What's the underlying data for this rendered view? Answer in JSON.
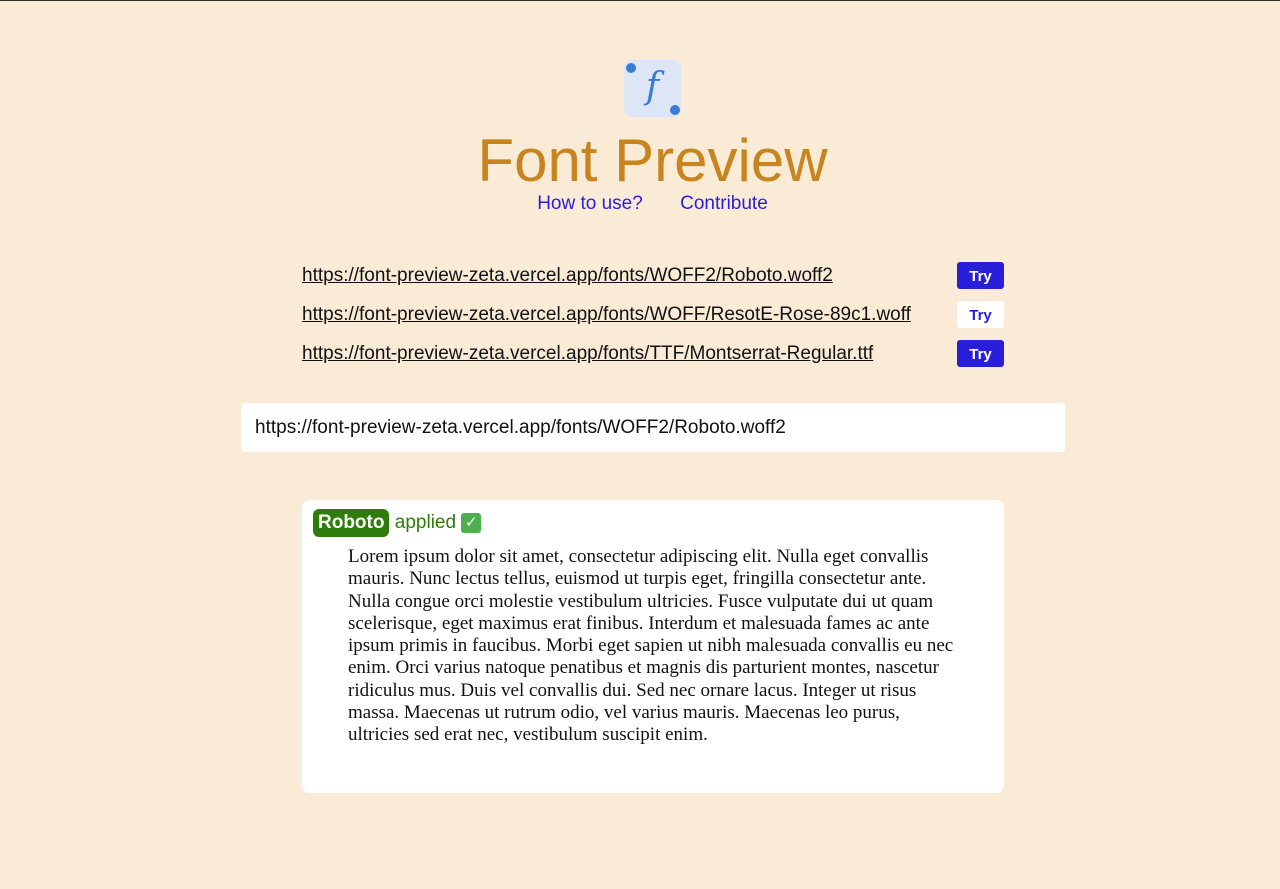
{
  "app": {
    "logo_glyph": "f",
    "title": "Font Preview"
  },
  "nav": {
    "how_to_use": "How to use?",
    "contribute": "Contribute"
  },
  "font_rows": [
    {
      "url": "https://font-preview-zeta.vercel.app/fonts/WOFF2/Roboto.woff2",
      "button": "Try",
      "style": "primary"
    },
    {
      "url": "https://font-preview-zeta.vercel.app/fonts/WOFF/ResotE-Rose-89c1.woff",
      "button": "Try",
      "style": "secondary"
    },
    {
      "url": "https://font-preview-zeta.vercel.app/fonts/TTF/Montserrat-Regular.ttf",
      "button": "Try",
      "style": "primary"
    }
  ],
  "input": {
    "value": "https://font-preview-zeta.vercel.app/fonts/WOFF2/Roboto.woff2"
  },
  "preview": {
    "font_name": "Roboto",
    "status_text": "applied",
    "status_icon": "check-mark-icon",
    "sample_text": "Lorem ipsum dolor sit amet, consectetur adipiscing elit. Nulla eget convallis mauris. Nunc lectus tellus, euismod ut turpis eget, fringilla consectetur ante. Nulla congue orci molestie vestibulum ultricies. Fusce vulputate dui ut quam scelerisque, eget maximus erat finibus. Interdum et malesuada fames ac ante ipsum primis in faucibus. Morbi eget sapien ut nibh malesuada convallis eu nec enim. Orci varius natoque penatibus et magnis dis parturient montes, nascetur ridiculus mus. Duis vel convallis dui. Sed nec ornare lacus. Integer ut risus massa. Maecenas ut rutrum odio, vel varius mauris. Maecenas leo purus, ultricies sed erat nec, vestibulum suscipit enim."
  },
  "colors": {
    "background": "#faebd7",
    "title": "#c8841e",
    "link": "#2a1fd9",
    "button_primary": "#2a1fd9",
    "status_green": "#2e7d0a",
    "logo_bg": "#dce6f7",
    "logo_accent": "#3a7bd5"
  }
}
